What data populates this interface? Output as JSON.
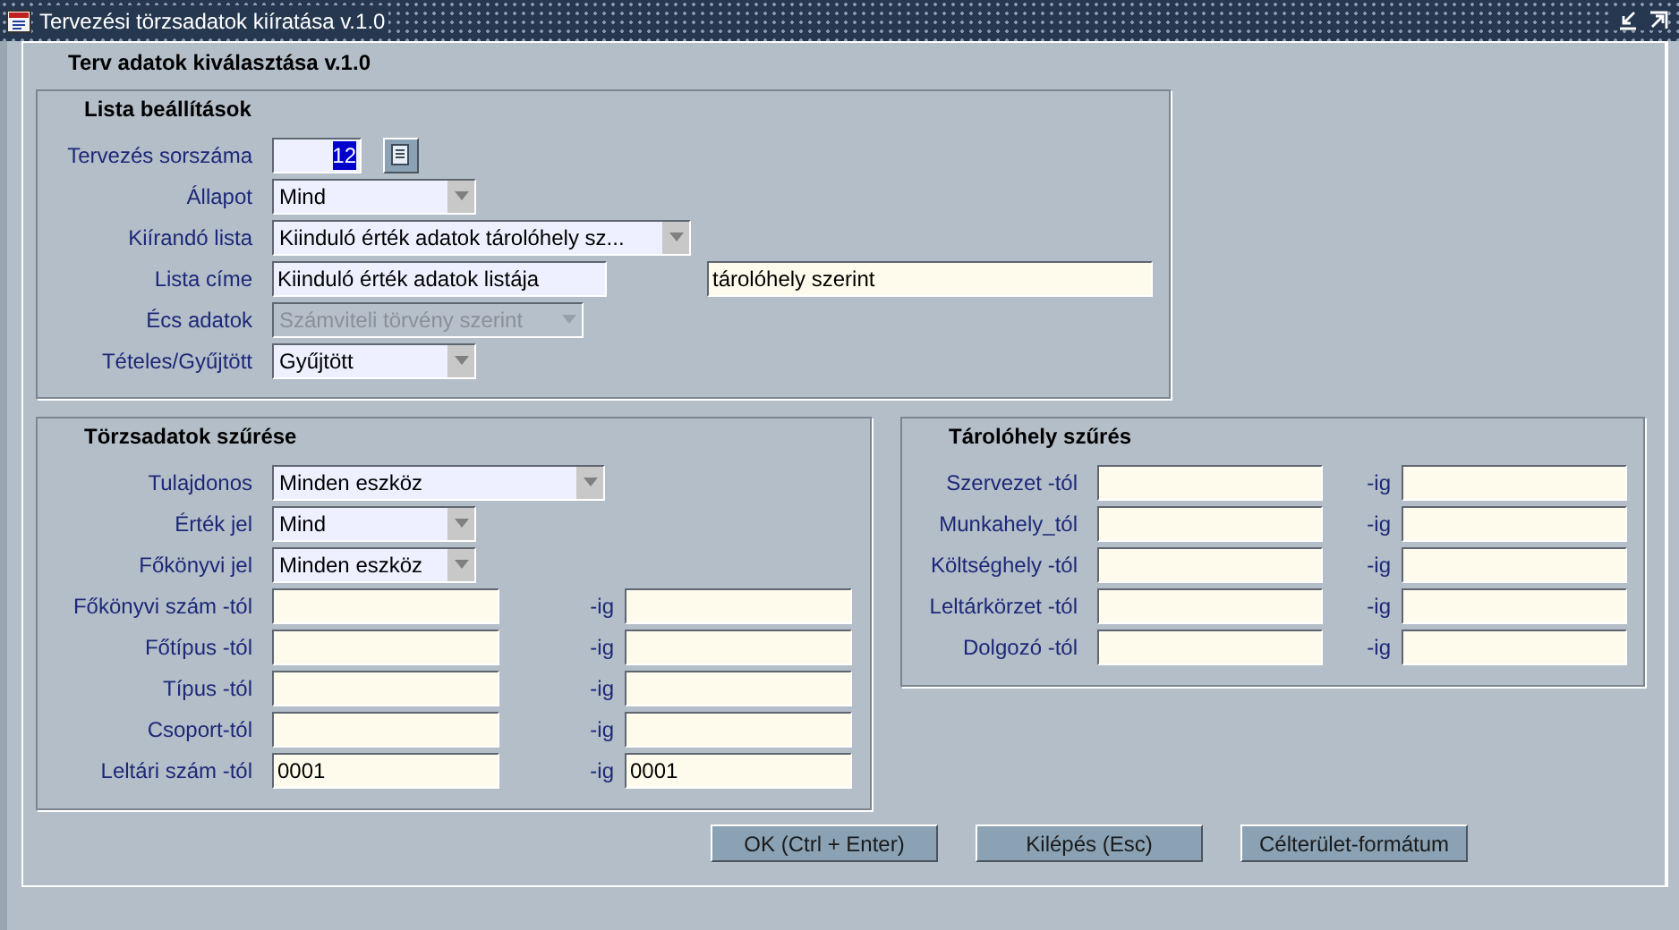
{
  "window": {
    "title": "Tervezési törzsadatok kiíratása v.1.0"
  },
  "heading": "Terv adatok kiválasztása v.1.0",
  "list_settings": {
    "title": "Lista beállítások",
    "rows": [
      {
        "kind": "number",
        "label": "Tervezés sorszáma",
        "value": "12",
        "highlighted": true
      },
      {
        "kind": "select",
        "label": "Állapot",
        "value": "Mind",
        "disabled": false
      },
      {
        "kind": "select",
        "label": "Kiírandó lista",
        "value": "Kiinduló érték adatok tárolóhely sz...",
        "disabled": false
      },
      {
        "kind": "text_pair",
        "label": "Lista címe",
        "values": [
          "Kiinduló érték adatok listája",
          "tárolóhely szerint"
        ]
      },
      {
        "kind": "select",
        "label": "Écs adatok",
        "value": "Számviteli törvény szerint",
        "disabled": true
      },
      {
        "kind": "select",
        "label": "Tételes/Gyűjtött",
        "value": "Gyűjtött",
        "disabled": false
      }
    ]
  },
  "asset_filter": {
    "title": "Törzsadatok szűrése",
    "selects": [
      {
        "label": "Tulajdonos",
        "value": "Minden eszköz"
      },
      {
        "label": "Érték jel",
        "value": "Mind"
      },
      {
        "label": "Főkönyvi jel",
        "value": "Minden eszköz"
      }
    ],
    "ranges": [
      {
        "label": "Főkönyvi szám -tól",
        "to_label": "-ig"
      },
      {
        "label": "Főtípus -tól",
        "to_label": "-ig"
      },
      {
        "label": "Típus -tól",
        "to_label": "-ig"
      },
      {
        "label": "Csoport-tól",
        "to_label": "-ig"
      },
      {
        "label": "Leltári szám -tól",
        "to_label": "-ig",
        "from": "0001",
        "to": "0001"
      }
    ]
  },
  "location_filter": {
    "title": "Tárolóhely szűrés",
    "ranges": [
      {
        "label": "Szervezet -tól",
        "to_label": "-ig"
      },
      {
        "label": "Munkahely_tól",
        "to_label": "-ig"
      },
      {
        "label": "Költséghely -tól",
        "to_label": "-ig"
      },
      {
        "label": "Leltárkörzet -tól",
        "to_label": "-ig"
      },
      {
        "label": "Dolgozó -tól",
        "to_label": "-ig"
      }
    ]
  },
  "buttons": [
    "OK (Ctrl + Enter)",
    "Kilépés (Esc)",
    "Célterület-formátum"
  ]
}
